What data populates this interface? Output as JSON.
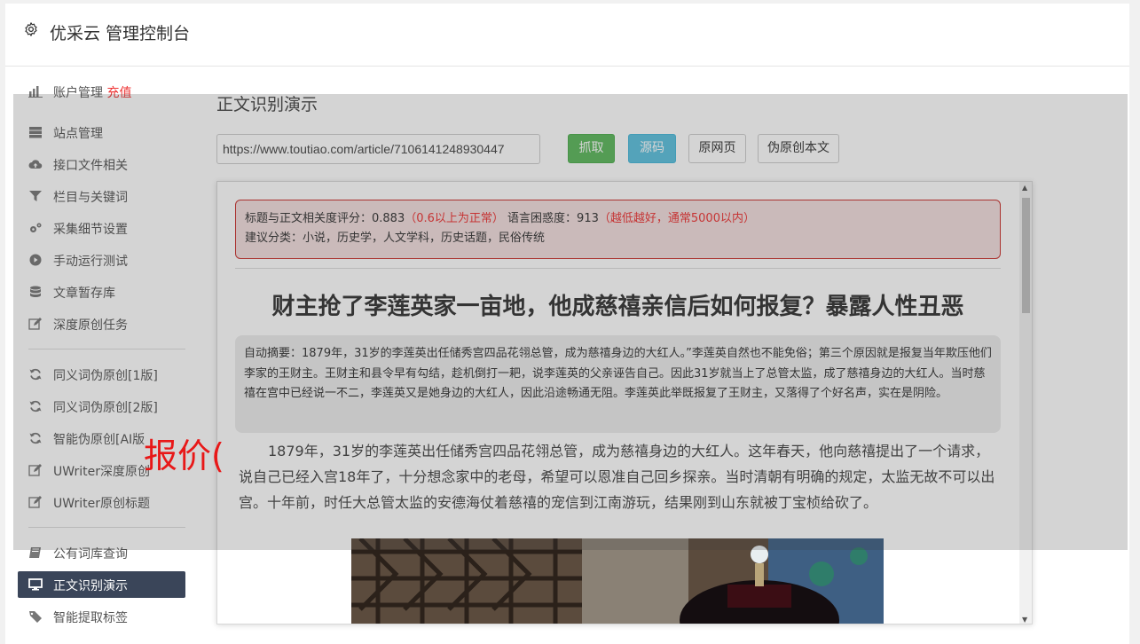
{
  "header": {
    "title": "优采云 管理控制台",
    "icon": "gear-icon"
  },
  "sidebar": {
    "items": [
      {
        "label": "账户管理",
        "badge": "充值",
        "icon": "bar-chart-icon"
      },
      {
        "label": "站点管理",
        "icon": "server-icon"
      },
      {
        "label": "接口文件相关",
        "icon": "cloud-upload-icon"
      },
      {
        "label": "栏目与关键词",
        "icon": "filter-icon"
      },
      {
        "label": "采集细节设置",
        "icon": "gears-icon"
      },
      {
        "label": "手动运行测试",
        "icon": "play-circle-icon"
      },
      {
        "label": "文章暂存库",
        "icon": "database-icon"
      },
      {
        "label": "深度原创任务",
        "icon": "edit-icon"
      },
      {
        "label": "同义词伪原创[1版]",
        "icon": "refresh-icon"
      },
      {
        "label": "同义词伪原创[2版]",
        "icon": "refresh-icon"
      },
      {
        "label": "智能伪原创[AI版",
        "icon": "refresh-icon"
      },
      {
        "label": "UWriter深度原创",
        "icon": "edit-icon"
      },
      {
        "label": "UWriter原创标题",
        "icon": "edit-icon"
      },
      {
        "label": "公有词库查询",
        "icon": "book-icon"
      },
      {
        "label": "正文识别演示",
        "icon": "desktop-icon",
        "active": true
      },
      {
        "label": "智能提取标签",
        "icon": "tag-icon"
      }
    ]
  },
  "main": {
    "title": "正文识别演示",
    "url_value": "https://www.toutiao.com/article/7106141248930447",
    "buttons": {
      "fetch": "抓取",
      "source": "源码",
      "original": "原网页",
      "pseudo": "伪原创本文"
    }
  },
  "preview": {
    "score_label": "标题与正文相关度评分：0.883",
    "score_hint": "（0.6以上为正常）",
    "perplexity_label": "语言困惑度：913",
    "perplexity_hint": "（越低越好，通常5000以内）",
    "category_line": "建议分类：小说，历史学，人文学科，历史话题，民俗传统",
    "article_title": "财主抢了李莲英家一亩地，他成慈禧亲信后如何报复？暴露人性丑恶",
    "summary": "自动摘要：1879年，31岁的李莲英出任储秀宫四品花翎总管，成为慈禧身边的大红人。”李莲英自然也不能免俗；第三个原因就是报复当年欺压他们李家的王财主。王财主和县令早有勾结，趁机倒打一耙，说李莲英的父亲诬告自己。因此31岁就当上了总管太监，成了慈禧身边的大红人。当时慈禧在宫中已经说一不二，李莲英又是她身边的大红人，因此沿途畅通无阻。李莲英此举既报复了王财主，又落得了个好名声，实在是阴险。",
    "body": "1879年，31岁的李莲英出任储秀宫四品花翎总管，成为慈禧身边的大红人。这年春天，他向慈禧提出了一个请求，说自己已经入宫18年了，十分想念家中的老母，希望可以恩准自己回乡探亲。当时清朝有明确的规定，太监无故不可以出宫。十年前，时任大总管太监的安德海仗着慈禧的宠信到江南游玩，结果刚到山东就被丁宝桢给砍了。"
  },
  "overlay": {
    "label": "报价("
  }
}
